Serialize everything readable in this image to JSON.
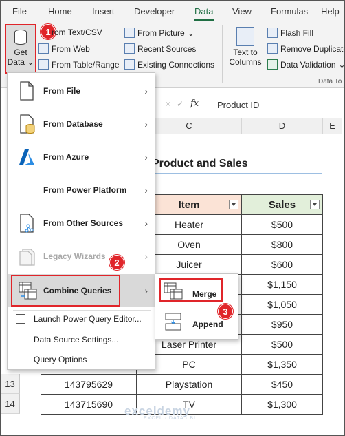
{
  "menu": {
    "tabs": [
      "File",
      "Home",
      "Insert",
      "Developer",
      "Data",
      "View",
      "Formulas",
      "Help"
    ],
    "active_tab": "Data"
  },
  "ribbon": {
    "get_data_line1": "Get",
    "get_data_line2": "Data",
    "from_text_csv": "rom Text/CSV",
    "from_web": "From Web",
    "from_table_range": "From Table/Range",
    "from_picture": "From Picture",
    "recent_sources": "Recent Sources",
    "existing_connections": "Existing Connections",
    "text_to_columns_1": "Text to",
    "text_to_columns_2": "Columns",
    "flash_fill": "Flash Fill",
    "remove_duplicates": "Remove Duplicate",
    "data_validation": "Data Validation",
    "group_label": "Data To"
  },
  "formula_bar": {
    "cancel_symbol": "×",
    "enter_symbol": "✓",
    "fx_symbol": "fx",
    "value": "Product ID"
  },
  "sheet": {
    "column_headers": [
      "C",
      "D",
      "E"
    ],
    "title": "Product and Sales",
    "headers": {
      "item": "Item",
      "sales": "Sales"
    },
    "rows": [
      {
        "id": "",
        "item": "Heater",
        "sales": "$500"
      },
      {
        "id": "",
        "item": "Oven",
        "sales": "$800"
      },
      {
        "id": "",
        "item": "Juicer",
        "sales": "$600"
      },
      {
        "id": "",
        "item": "",
        "sales": "$1,150"
      },
      {
        "id": "",
        "item": "",
        "sales": "$1,050"
      },
      {
        "id": "",
        "item": "",
        "sales": "$950"
      },
      {
        "id": "",
        "item": "Laser Printer",
        "sales": "$500"
      },
      {
        "id": "",
        "item": "PC",
        "sales": "$1,350"
      },
      {
        "id": "143795629",
        "item": "Playstation",
        "sales": "$450"
      },
      {
        "id": "143715690",
        "item": "TV",
        "sales": "$1,300"
      }
    ],
    "row_numbers": [
      "13",
      "14"
    ]
  },
  "dropdown": {
    "items": [
      {
        "label": "From File",
        "icon": "file-icon"
      },
      {
        "label": "From Database",
        "icon": "database-icon"
      },
      {
        "label": "From Azure",
        "icon": "azure-icon"
      },
      {
        "label": "From Power Platform",
        "icon": ""
      },
      {
        "label": "From Other Sources",
        "icon": "other-sources-icon"
      },
      {
        "label": "Legacy Wizards",
        "icon": "legacy-wizards-icon"
      },
      {
        "label": "Combine Queries",
        "icon": "combine-queries-icon"
      }
    ],
    "launch_editor": "Launch Power Query Editor...",
    "data_source_settings": "Data Source Settings...",
    "query_options": "Query Options",
    "arrow": "›"
  },
  "submenu": {
    "merge": "Merge",
    "append": "Append"
  },
  "badges": [
    "1",
    "2",
    "3"
  ],
  "watermark": {
    "name": "exceldemy",
    "tagline": "EXCEL · DATA · BI"
  },
  "colors": {
    "accent": "#1f6e43",
    "highlight": "#e0252a",
    "item_header": "#fbe3d6",
    "sales_header": "#e2efda"
  }
}
